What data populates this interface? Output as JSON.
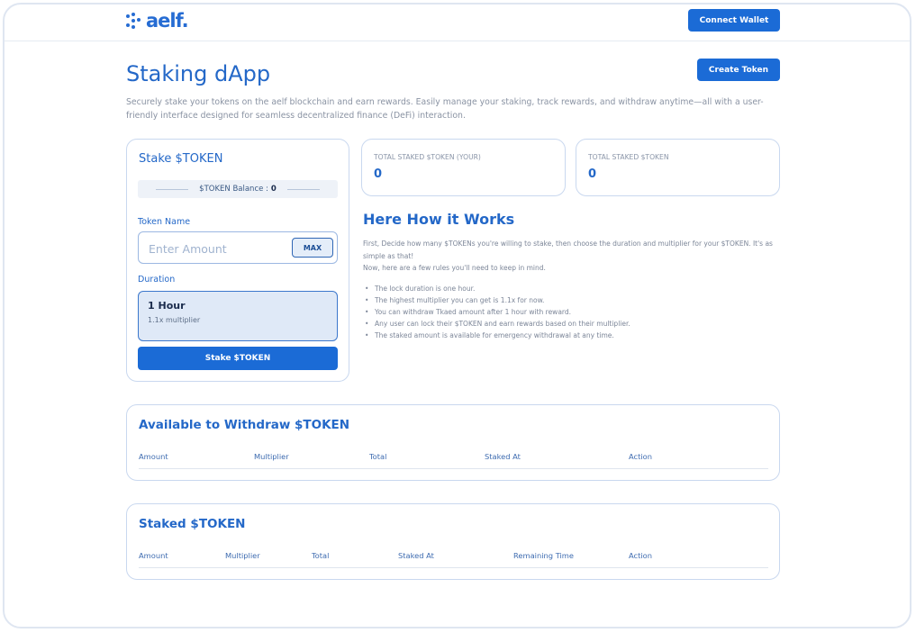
{
  "header": {
    "logo_text": "aelf.",
    "connect_wallet_label": "Connect Wallet"
  },
  "page": {
    "title": "Staking dApp",
    "description": "Securely stake your tokens on the aelf blockchain and earn rewards. Easily manage your staking, track rewards, and withdraw anytime—all with a user-friendly interface designed for seamless decentralized finance (DeFi) interaction.",
    "create_token_label": "Create Token"
  },
  "stake_form": {
    "title": "Stake $TOKEN",
    "balance_label": "$TOKEN Balance :",
    "balance_value": "0",
    "token_name_label": "Token Name",
    "amount_placeholder": "Enter Amount",
    "max_label": "MAX",
    "duration_label": "Duration",
    "duration_option": {
      "name": "1 Hour",
      "multiplier": "1.1x multiplier"
    },
    "submit_label": "Stake $TOKEN"
  },
  "stats": [
    {
      "label": "TOTAL STAKED $TOKEN (YOUR)",
      "value": "0"
    },
    {
      "label": "TOTAL STAKED $TOKEN",
      "value": "0"
    }
  ],
  "how_it_works": {
    "title": "Here How it Works",
    "intro_1": "First, Decide how many $TOKENs you're willing to stake, then choose the duration and multiplier for your $TOKEN. It's as simple as that!",
    "intro_2": "Now, here are a few rules you'll need to keep in mind.",
    "rules": [
      "The lock duration is one hour.",
      "The highest multiplier you can get is 1.1x for now.",
      "You can withdraw Tkaed amount after 1 hour with reward.",
      "Any user can lock their $TOKEN and earn rewards based on their multiplier.",
      "The staked amount is available for emergency withdrawal at any time."
    ]
  },
  "withdraw_table": {
    "title": "Available to Withdraw $TOKEN",
    "columns": [
      "Amount",
      "Multiplier",
      "Total",
      "Staked At",
      "Action"
    ]
  },
  "staked_table": {
    "title": "Staked $TOKEN",
    "columns": [
      "Amount",
      "Multiplier",
      "Total",
      "Staked At",
      "Remaining Time",
      "Action"
    ]
  },
  "colors": {
    "brand_blue": "#1b6bd6",
    "title_blue": "#2468c8",
    "border": "#c9d8ef"
  }
}
